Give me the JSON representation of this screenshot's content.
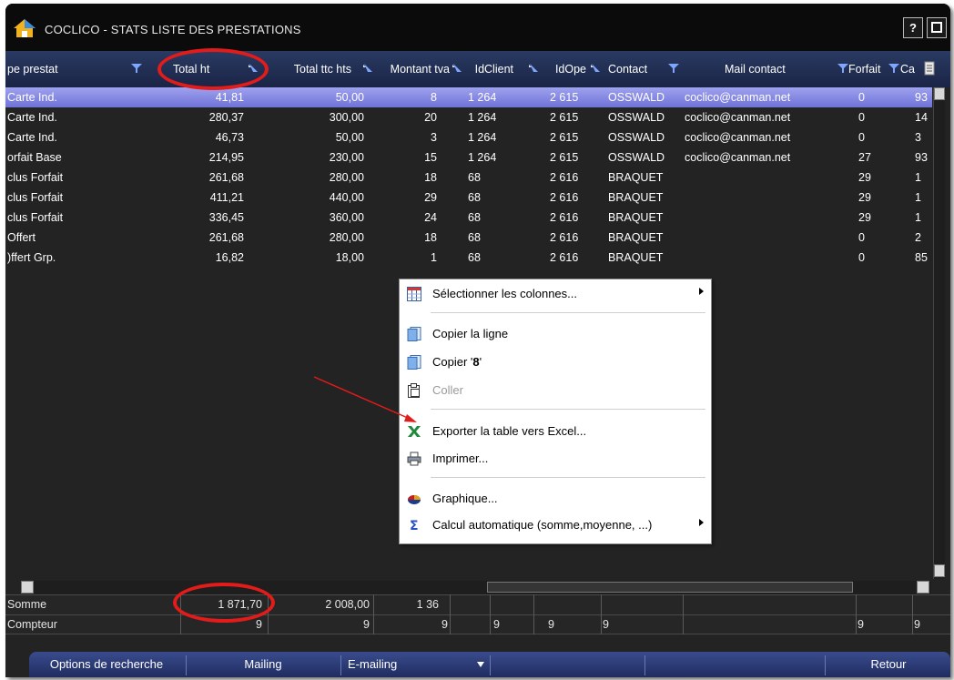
{
  "window": {
    "title": "COCLICO - STATS LISTE DES PRESTATIONS",
    "help_label": "?",
    "max_label": ""
  },
  "columns": [
    {
      "label": "pe prestat",
      "filter": "funnel"
    },
    {
      "label": "Total ht",
      "filter": "sort"
    },
    {
      "label": "Total ttc hts",
      "filter": "sort"
    },
    {
      "label": "Montant tva",
      "filter": "sort"
    },
    {
      "label": "IdClient",
      "filter": "sort"
    },
    {
      "label": "IdOpe",
      "filter": "sort"
    },
    {
      "label": "Contact",
      "filter": "funnel"
    },
    {
      "label": "Mail contact",
      "filter": "none"
    },
    {
      "label": "Forfait",
      "filter": "funnel"
    },
    {
      "label": "Ca",
      "filter": "funnel"
    }
  ],
  "rows": [
    {
      "type": "Carte Ind.",
      "total_ht": "41,81",
      "total_ttc": "50,00",
      "tva": "8",
      "idclient": "1 264",
      "idope": "2 615",
      "contact": "OSSWALD",
      "mail": "coclico@canman.net",
      "forfait": "0",
      "ca": "93",
      "selected": true
    },
    {
      "type": "Carte Ind.",
      "total_ht": "280,37",
      "total_ttc": "300,00",
      "tva": "20",
      "idclient": "1 264",
      "idope": "2 615",
      "contact": "OSSWALD",
      "mail": "coclico@canman.net",
      "forfait": "0",
      "ca": "14"
    },
    {
      "type": "Carte Ind.",
      "total_ht": "46,73",
      "total_ttc": "50,00",
      "tva": "3",
      "idclient": "1 264",
      "idope": "2 615",
      "contact": "OSSWALD",
      "mail": "coclico@canman.net",
      "forfait": "0",
      "ca": "3"
    },
    {
      "type": "orfait Base",
      "total_ht": "214,95",
      "total_ttc": "230,00",
      "tva": "15",
      "idclient": "1 264",
      "idope": "2 615",
      "contact": "OSSWALD",
      "mail": "coclico@canman.net",
      "forfait": "27",
      "ca": "93"
    },
    {
      "type": "clus Forfait",
      "total_ht": "261,68",
      "total_ttc": "280,00",
      "tva": "18",
      "idclient": "68",
      "idope": "2 616",
      "contact": "BRAQUET",
      "mail": "",
      "forfait": "29",
      "ca": "1"
    },
    {
      "type": "clus Forfait",
      "total_ht": "411,21",
      "total_ttc": "440,00",
      "tva": "29",
      "idclient": "68",
      "idope": "2 616",
      "contact": "BRAQUET",
      "mail": "",
      "forfait": "29",
      "ca": "1"
    },
    {
      "type": "clus Forfait",
      "total_ht": "336,45",
      "total_ttc": "360,00",
      "tva": "24",
      "idclient": "68",
      "idope": "2 616",
      "contact": "BRAQUET",
      "mail": "",
      "forfait": "29",
      "ca": "1"
    },
    {
      "type": "Offert",
      "total_ht": "261,68",
      "total_ttc": "280,00",
      "tva": "18",
      "idclient": "68",
      "idope": "2 616",
      "contact": "BRAQUET",
      "mail": "",
      "forfait": "0",
      "ca": "2"
    },
    {
      "type": ")ffert Grp.",
      "total_ht": "16,82",
      "total_ttc": "18,00",
      "tva": "1",
      "idclient": "68",
      "idope": "2 616",
      "contact": "BRAQUET",
      "mail": "",
      "forfait": "0",
      "ca": "85"
    }
  ],
  "summary": {
    "somme_label": "Somme",
    "compteur_label": "Compteur",
    "somme_total_ht": "1 871,70",
    "somme_total_ttc": "2 008,00",
    "somme_tva": "1 36",
    "compteur_values": [
      "9",
      "9",
      "9",
      "9",
      "9",
      "9",
      "9",
      "9"
    ]
  },
  "context_menu": {
    "items": [
      {
        "label": "Sélectionner les colonnes...",
        "icon": "columns-icon",
        "submenu": true
      },
      {
        "label": "Copier la ligne",
        "icon": "copy-icon"
      },
      {
        "label": "Copier '8'",
        "prefix": "Copier '",
        "bold": "8",
        "suffix": "'",
        "icon": "copy-icon"
      },
      {
        "label": "Coller",
        "icon": "paste-icon",
        "disabled": true
      },
      {
        "label": "Exporter la table vers Excel...",
        "icon": "excel-icon"
      },
      {
        "label": "Imprimer...",
        "icon": "printer-icon"
      },
      {
        "label": "Graphique...",
        "icon": "chart-icon"
      },
      {
        "label": "Calcul automatique (somme,moyenne, ...)",
        "icon": "sigma-icon",
        "submenu": true
      }
    ]
  },
  "bottom_bar": {
    "search_options": "Options de recherche",
    "mailing": "Mailing",
    "emailing": "E-mailing",
    "back": "Retour"
  },
  "colors": {
    "header": "#1f2b52",
    "selected_row": "#8589e4",
    "annotation": "#e21b1b",
    "background": "#232323"
  }
}
